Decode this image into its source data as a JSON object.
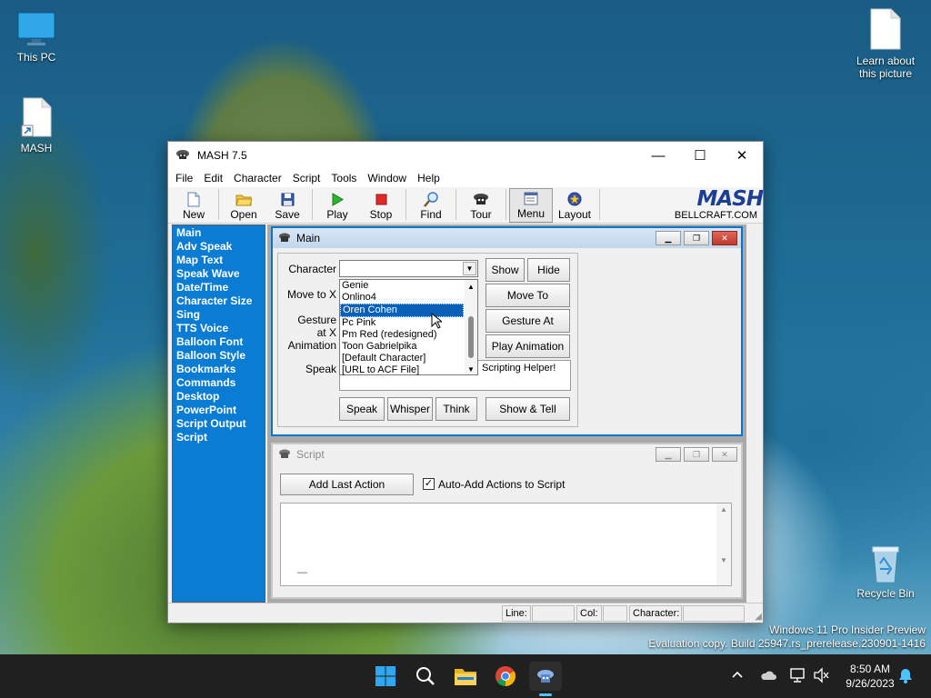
{
  "desktop": {
    "icons": [
      {
        "label": "This PC",
        "icon": "monitor-icon"
      },
      {
        "label": "MASH",
        "icon": "file-shortcut-icon"
      },
      {
        "label": "Learn about this picture",
        "icon": "file-icon"
      },
      {
        "label": "Recycle Bin",
        "icon": "recycle-bin-icon"
      }
    ],
    "watermark": {
      "line1": "Windows 11 Pro Insider Preview",
      "line2": "Evaluation copy. Build 25947.rs_prerelease.230901-1416"
    }
  },
  "window": {
    "title": "MASH 7.5",
    "controls": {
      "minimize": "—",
      "maximize": "☐",
      "close": "✕"
    },
    "menu": [
      "File",
      "Edit",
      "Character",
      "Script",
      "Tools",
      "Window",
      "Help"
    ],
    "toolbar": [
      {
        "label": "New",
        "icon": "new-file-icon"
      },
      {
        "label": "Open",
        "icon": "open-folder-icon"
      },
      {
        "label": "Save",
        "icon": "save-disk-icon"
      },
      {
        "label": "Play",
        "icon": "play-icon"
      },
      {
        "label": "Stop",
        "icon": "stop-icon"
      },
      {
        "label": "Find",
        "icon": "magnifier-icon"
      },
      {
        "label": "Tour",
        "icon": "tour-icon"
      },
      {
        "label": "Menu",
        "icon": "menu-icon"
      },
      {
        "label": "Layout",
        "icon": "layout-icon"
      }
    ],
    "logo": {
      "brand": "MASH",
      "url": "BELLCRAFT.COM"
    },
    "sidebar": [
      "Main",
      "Adv Speak",
      "Map Text",
      "Speak Wave",
      "Date/Time",
      "Character Size",
      "Sing",
      "TTS Voice",
      "Balloon Font",
      "Balloon Style",
      "Bookmarks",
      "Commands",
      "Desktop",
      "PowerPoint",
      "Script Output",
      "Script"
    ],
    "main_panel": {
      "title": "Main",
      "labels": {
        "character": "Character",
        "move_to": "Move to",
        "gesture_at": "Gesture at",
        "animation": "Animation",
        "speak": "Speak",
        "x": "X"
      },
      "character_value": "",
      "dropdown_options": [
        "Genie",
        "Onlino4",
        "Oren Cohen",
        "Pc Pink",
        "Pm Red (redesigned)",
        "Toon Gabrielpika",
        "[Default Character]",
        "[URL to ACF File]"
      ],
      "highlighted_option": "Oren Cohen",
      "speak_text_visible": "Scripting Helper!",
      "buttons": {
        "show": "Show",
        "hide": "Hide",
        "move_to": "Move To",
        "gesture_at": "Gesture At",
        "play_animation": "Play Animation",
        "speak": "Speak",
        "whisper": "Whisper",
        "think": "Think",
        "show_tell": "Show & Tell"
      }
    },
    "script_panel": {
      "title": "Script",
      "add_last_action": "Add Last Action",
      "auto_add_label": "Auto-Add Actions to Script",
      "auto_add_checked": true,
      "content": "—"
    },
    "statusbar": {
      "line": "Line:",
      "col": "Col:",
      "character": "Character:"
    }
  },
  "taskbar": {
    "apps": [
      "start-icon",
      "search-icon",
      "file-explorer-icon",
      "chrome-icon",
      "mash-icon"
    ],
    "time": "8:50 AM",
    "date": "9/26/2023"
  }
}
